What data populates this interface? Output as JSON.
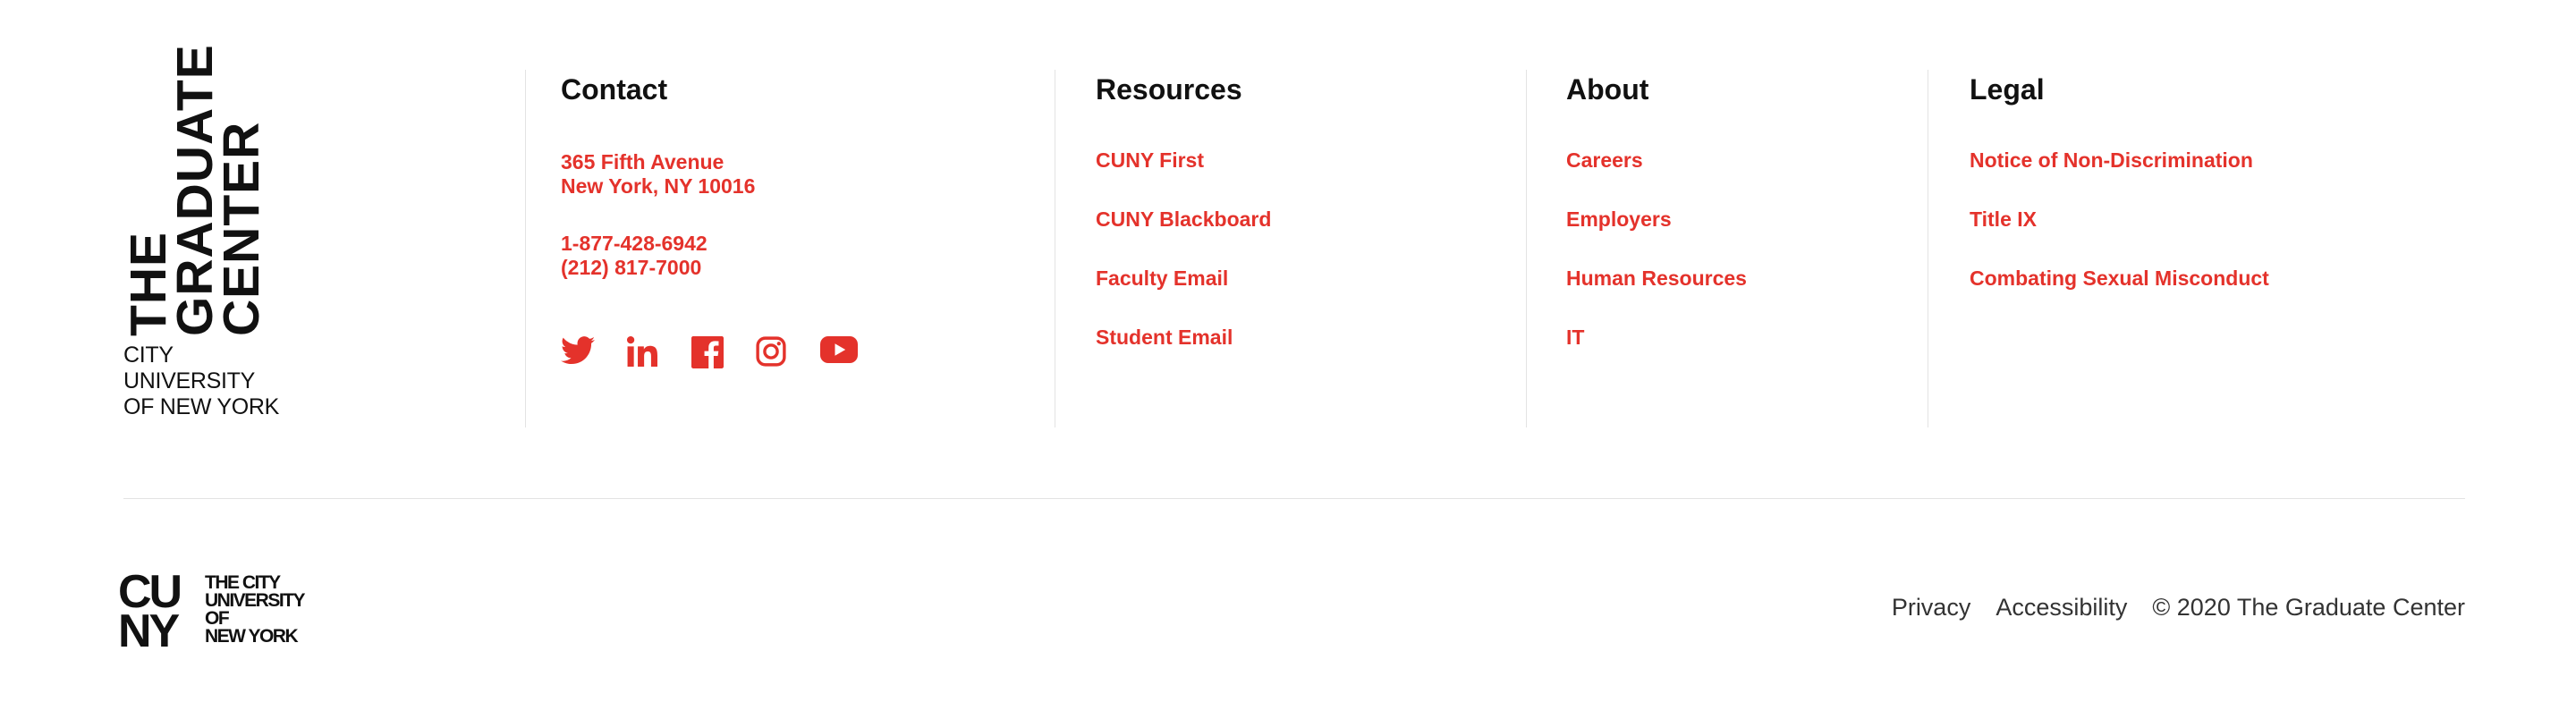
{
  "brand": {
    "gc_logo_lines": [
      "THE",
      "GRADUATE",
      "CENTER"
    ],
    "gc_logo_sub": [
      "CITY UNIVERSITY",
      "OF NEW YORK"
    ],
    "cuny_logo_big": [
      "CU",
      "NY"
    ],
    "cuny_logo_small": [
      "THE CITY",
      "UNIVERSITY",
      "OF",
      "NEW YORK"
    ]
  },
  "contact": {
    "title": "Contact",
    "address_line1": "365 Fifth Avenue",
    "address_line2": "New York, NY 10016",
    "phone1": "1-877-428-6942",
    "phone2": "(212) 817-7000",
    "social": [
      {
        "icon": "twitter-icon"
      },
      {
        "icon": "linkedin-icon"
      },
      {
        "icon": "facebook-icon"
      },
      {
        "icon": "instagram-icon"
      },
      {
        "icon": "youtube-icon"
      }
    ]
  },
  "resources": {
    "title": "Resources",
    "items": [
      "CUNY First",
      "CUNY Blackboard",
      "Faculty Email",
      "Student Email"
    ]
  },
  "about": {
    "title": "About",
    "items": [
      "Careers",
      "Employers",
      "Human Resources",
      "IT"
    ]
  },
  "legal": {
    "title": "Legal",
    "items": [
      "Notice of Non-Discrimination",
      "Title IX",
      "Combating Sexual Misconduct"
    ]
  },
  "footer": {
    "privacy": "Privacy",
    "accessibility": "Accessibility",
    "copyright": "© 2020 The Graduate Center"
  },
  "colors": {
    "accent": "#e4322b",
    "text": "#111111",
    "divider": "#e3e3e3"
  }
}
